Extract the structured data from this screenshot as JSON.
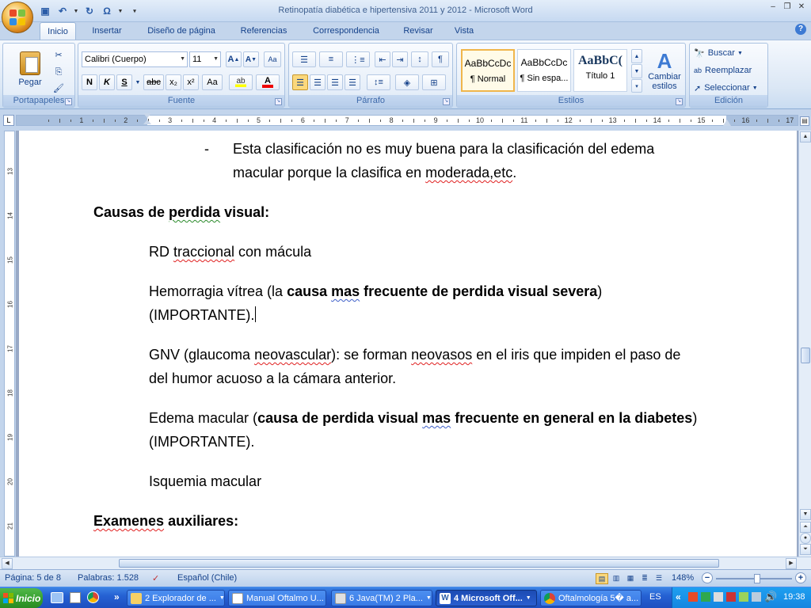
{
  "window": {
    "title": "Retinopatía diabética e hipertensiva 2011 y 2012 - Microsoft Word"
  },
  "tabs": [
    "Inicio",
    "Insertar",
    "Diseño de página",
    "Referencias",
    "Correspondencia",
    "Revisar",
    "Vista"
  ],
  "active_tab": "Inicio",
  "ribbon": {
    "clipboard": {
      "label": "Portapapeles",
      "paste": "Pegar"
    },
    "font": {
      "label": "Fuente",
      "name": "Calibri (Cuerpo)",
      "size": "11",
      "buttons": {
        "bold": "N",
        "italic": "K",
        "underline": "S",
        "strike": "abc",
        "subscript": "x₂",
        "superscript": "x²",
        "case": "Aa"
      }
    },
    "paragraph": {
      "label": "Párrafo"
    },
    "styles": {
      "label": "Estilos",
      "change": "Cambiar estilos",
      "items": [
        {
          "sample": "AaBbCcDc",
          "name": "¶ Normal"
        },
        {
          "sample": "AaBbCcDc",
          "name": "¶ Sin espa..."
        },
        {
          "sample": "AaBbC(",
          "name": "Título 1"
        }
      ]
    },
    "editing": {
      "label": "Edición",
      "find": "Buscar",
      "replace": "Reemplazar",
      "select": "Seleccionar"
    }
  },
  "ruler": {
    "numbers": [
      "1",
      "2",
      "3",
      "4",
      "5",
      "6",
      "7",
      "8",
      "9",
      "10",
      "11",
      "12",
      "13",
      "14",
      "15",
      "16",
      "17"
    ],
    "vnumbers": [
      "13",
      "14",
      "15",
      "16",
      "17",
      "18",
      "19",
      "20",
      "21"
    ]
  },
  "document": {
    "bullet": {
      "dash": "-",
      "line1": "Esta clasificación no es muy buena para la clasificación del edema",
      "line2_a": "macular porque la clasifica en ",
      "line2_b": "moderada,etc",
      "line2_c": "."
    },
    "heading1": {
      "a": "Causas de ",
      "b": "perdida",
      "c": " visual:"
    },
    "p1": {
      "a": "RD ",
      "b": "traccional",
      "c": " con mácula"
    },
    "p2": {
      "a": "Hemorragia vítrea (la ",
      "b": "causa ",
      "c": "mas",
      "d": " frecuente de perdida visual severa",
      "e": ")",
      "line2": "(IMPORTANTE)."
    },
    "p3": {
      "a": "GNV (glaucoma ",
      "b": "neovascular",
      "c": "): se forman ",
      "d": "neovasos",
      "e": " en el iris que impiden el paso de",
      "line2": "del humor acuoso a la cámara anterior."
    },
    "p4": {
      "a": "Edema macular (",
      "b": "causa de perdida visual ",
      "c": "mas",
      "d": " frecuente en general en la diabetes",
      "e": ")",
      "line2": "(IMPORTANTE)."
    },
    "p5": {
      "a": "Isquemia macular"
    },
    "heading2": {
      "a": "Examenes",
      "b": " auxiliares:"
    }
  },
  "status": {
    "page": "Página: 5 de 8",
    "words": "Palabras: 1.528",
    "language": "Español (Chile)",
    "zoom": "148%"
  },
  "taskbar": {
    "start": "Inicio",
    "buttons": [
      "2 Explorador de ...",
      "Manual Oftalmo U...",
      "6 Java(TM) 2 Pla...",
      "4 Microsoft Off...",
      "Oftalmología 5� a..."
    ],
    "lang": "ES",
    "clock": "19:38"
  }
}
